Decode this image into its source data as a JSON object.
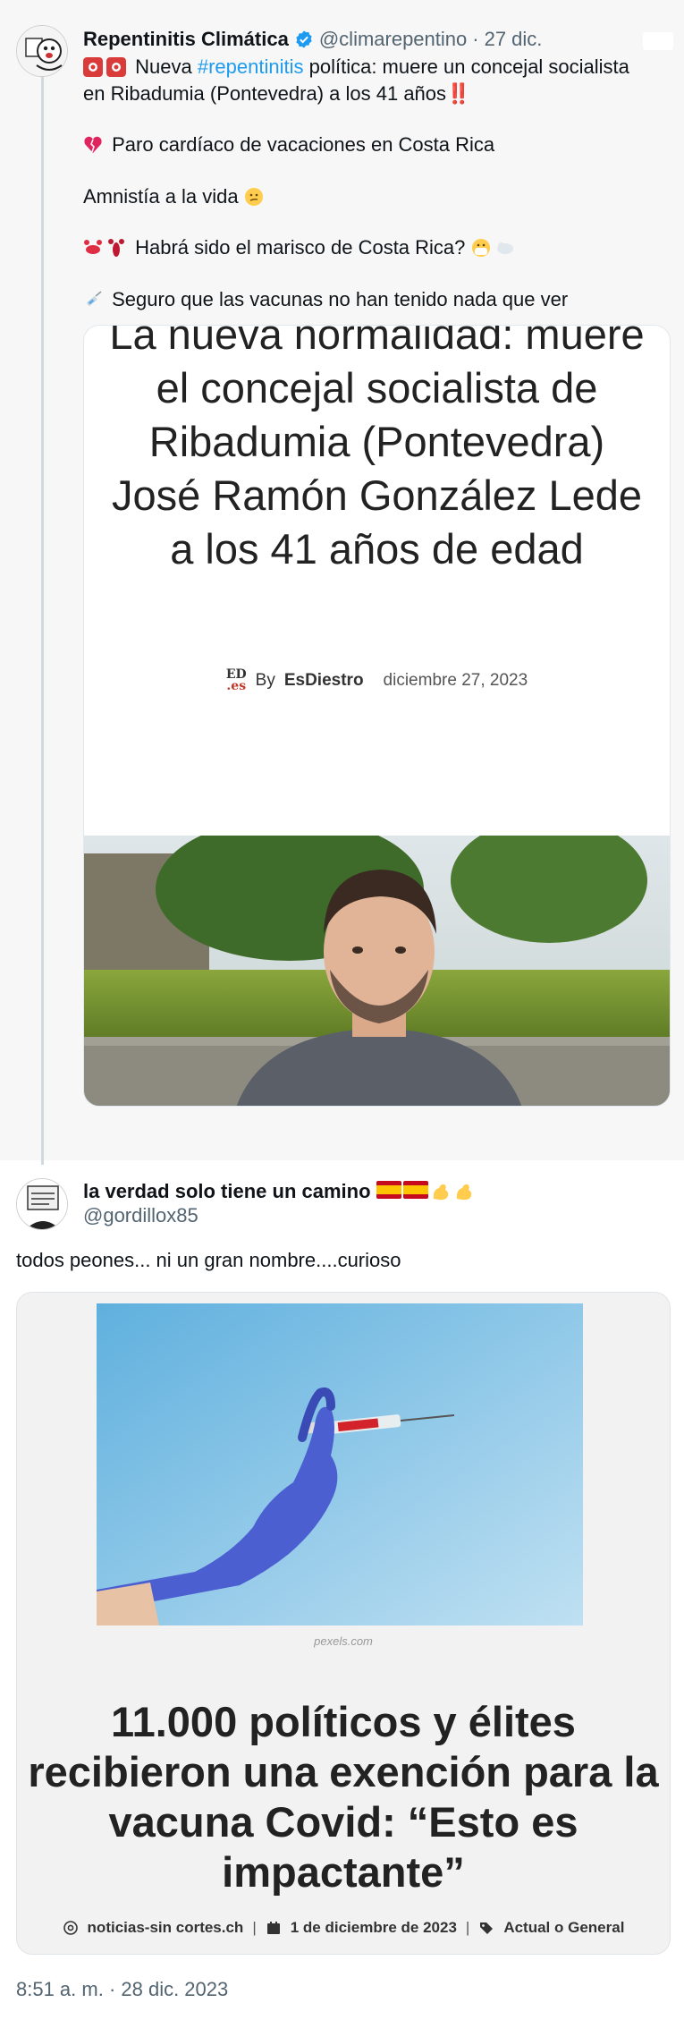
{
  "parent_tweet": {
    "display_name": "Repentinitis Climática",
    "handle": "@climarepentino",
    "separator": "·",
    "date": "27 dic.",
    "line1_prefix": "Nueva",
    "hashtag": "#repentinitis",
    "line1_suffix": "política: muere un concejal socialista",
    "line2": "en Ribadumia (Pontevedra) a los 41 años",
    "line2_emoji": "‼️",
    "line3": "Paro cardíaco de vacaciones en Costa Rica",
    "line4": "Amnistía a la vida",
    "line5": "Habrá sido el marisco de Costa Rica?",
    "line6": "Seguro que las vacunas no han tenido nada que ver",
    "card": {
      "title": "La nueva normalidad: muere el concejal socialista de Ribadumia (Pontevedra) José Ramón González Lede a los 41 años de edad",
      "logo_top": "ED",
      "logo_bottom": ".es",
      "by": "By",
      "author": "EsDiestro",
      "date": "diciembre 27, 2023"
    }
  },
  "reply_tweet": {
    "display_name": "la verdad solo tiene un camino",
    "handle": "@gordillox85",
    "text": "todos peones... ni un gran nombre....curioso",
    "card": {
      "credit": "pexels.com",
      "title_line1": "11.000 políticos y élites",
      "title_line2": "recibieron una exención para la",
      "title_line3": "vacuna Covid: “Esto es",
      "title_line4": "impactante”",
      "source": "noticias-sin cortes.ch",
      "date": "1 de diciembre de 2023",
      "category": "Actual o General",
      "divider": "|"
    },
    "timestamp": "8:51 a. m. · 28 dic. 2023"
  },
  "colors": {
    "link": "#1d9bf0",
    "verified": "#1d9bf0",
    "secondary_text": "#536471"
  }
}
